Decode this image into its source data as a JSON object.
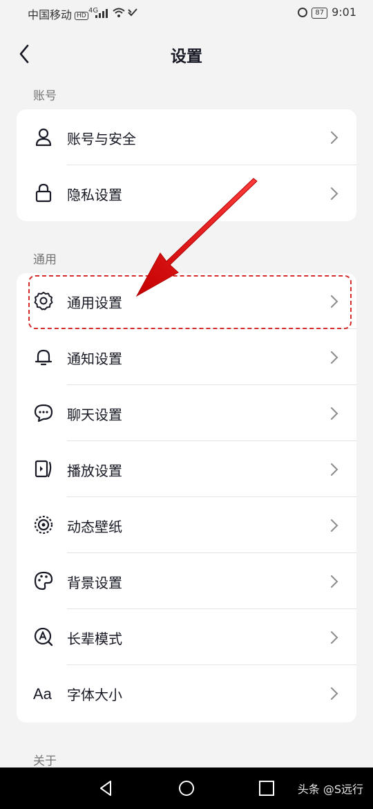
{
  "status_bar": {
    "carrier": "中国移动",
    "hd": "HD",
    "network": "4G",
    "battery": "87",
    "time": "9:01"
  },
  "header": {
    "title": "设置"
  },
  "sections": [
    {
      "label": "账号",
      "items": [
        {
          "label": "账号与安全",
          "icon": "user-icon"
        },
        {
          "label": "隐私设置",
          "icon": "lock-icon"
        }
      ]
    },
    {
      "label": "通用",
      "items": [
        {
          "label": "通用设置",
          "icon": "gear-icon"
        },
        {
          "label": "通知设置",
          "icon": "bell-icon"
        },
        {
          "label": "聊天设置",
          "icon": "chat-bubble-icon"
        },
        {
          "label": "播放设置",
          "icon": "play-icon"
        },
        {
          "label": "动态壁纸",
          "icon": "live-wallpaper-icon"
        },
        {
          "label": "背景设置",
          "icon": "palette-icon"
        },
        {
          "label": "长辈模式",
          "icon": "elder-mode-icon"
        },
        {
          "label": "字体大小",
          "icon": "font-size-icon"
        }
      ]
    },
    {
      "label": "关于"
    }
  ],
  "annotation": {
    "arrow_color": "#e02020"
  },
  "footer": {
    "watermark": "头条 @S远行"
  }
}
